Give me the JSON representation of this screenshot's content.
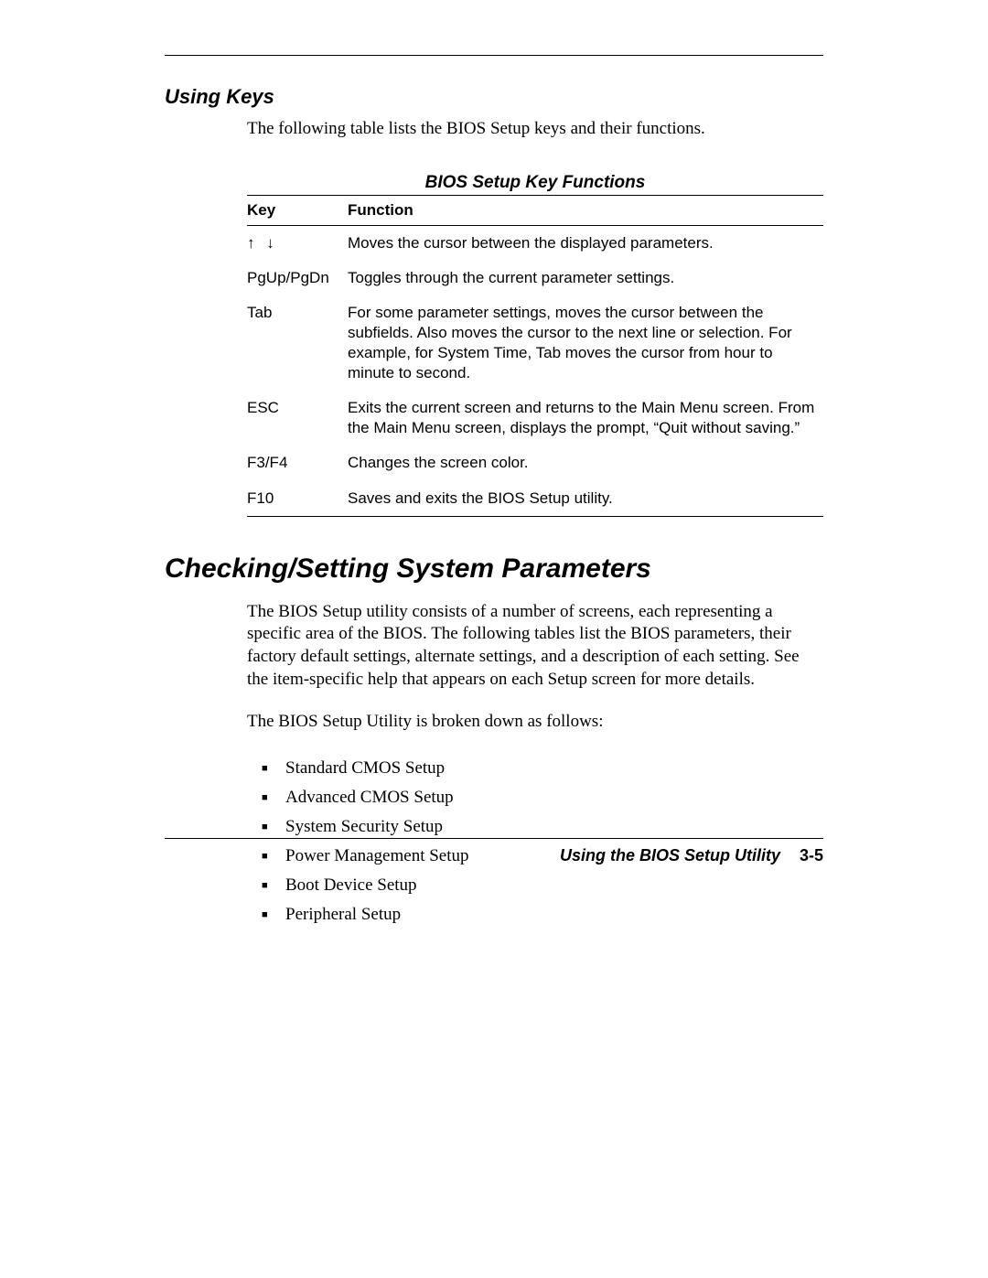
{
  "section1": {
    "heading": "Using Keys",
    "intro": "The following table lists the BIOS Setup keys and their functions.",
    "table_title": "BIOS Setup Key Functions",
    "columns": [
      "Key",
      "Function"
    ],
    "rows": [
      {
        "key": "↑ ↓",
        "function": "Moves the cursor between the displayed parameters."
      },
      {
        "key": "PgUp/PgDn",
        "function": "Toggles through the current parameter settings."
      },
      {
        "key": "Tab",
        "function": "For some parameter settings, moves the cursor between the subfields. Also moves the cursor to the next line or selection. For example, for System Time, Tab moves the cursor from hour to minute to second."
      },
      {
        "key": "ESC",
        "function": "Exits the current screen and returns to the Main Menu screen. From the Main Menu screen, displays the prompt, “Quit without saving.”"
      },
      {
        "key": "F3/F4",
        "function": "Changes the screen color."
      },
      {
        "key": "F10",
        "function": "Saves and exits the BIOS Setup utility."
      }
    ]
  },
  "section2": {
    "heading": "Checking/Setting System Parameters",
    "para1": "The BIOS Setup utility consists of a number of screens, each representing a specific area of the BIOS. The following tables list the BIOS parameters, their factory default settings, alternate settings, and a description of each setting. See the item-specific help that appears on each Setup screen for more details.",
    "para2": "The BIOS Setup Utility is broken down as follows:",
    "items": [
      "Standard CMOS Setup",
      "Advanced CMOS Setup",
      "System Security Setup",
      "Power Management Setup",
      "Boot Device Setup",
      "Peripheral Setup"
    ]
  },
  "footer": {
    "title": "Using the BIOS Setup Utility",
    "page": "3-5"
  }
}
